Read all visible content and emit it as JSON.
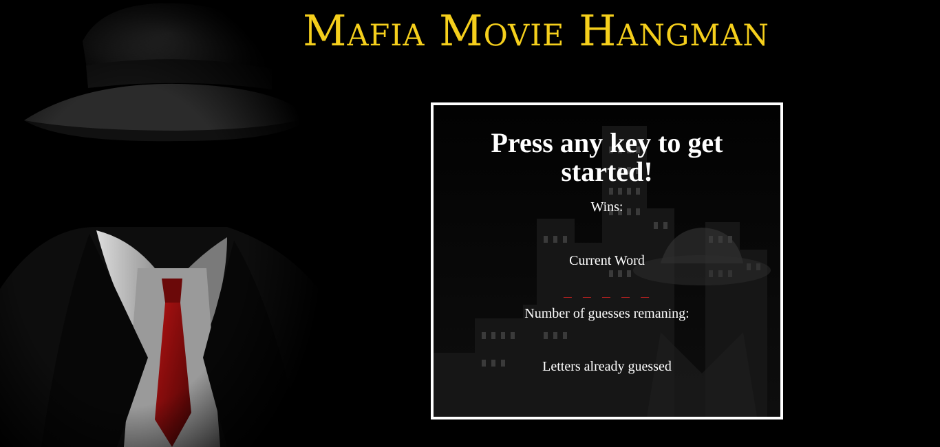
{
  "title": "Mafia Movie Hangman",
  "game": {
    "prompt": "Press any key to get started!",
    "wins_label": "Wins:",
    "current_word_label": "Current Word",
    "word_blanks": "_ _ _ _ _",
    "guesses_remaining_label": "Number of guesses remaning:",
    "letters_guessed_label": "Letters already guessed"
  },
  "colors": {
    "title": "#f5cf1c",
    "background": "#000000",
    "box_border": "#ffffff",
    "blanks": "#d32222",
    "tie": "#8a0b0b"
  }
}
